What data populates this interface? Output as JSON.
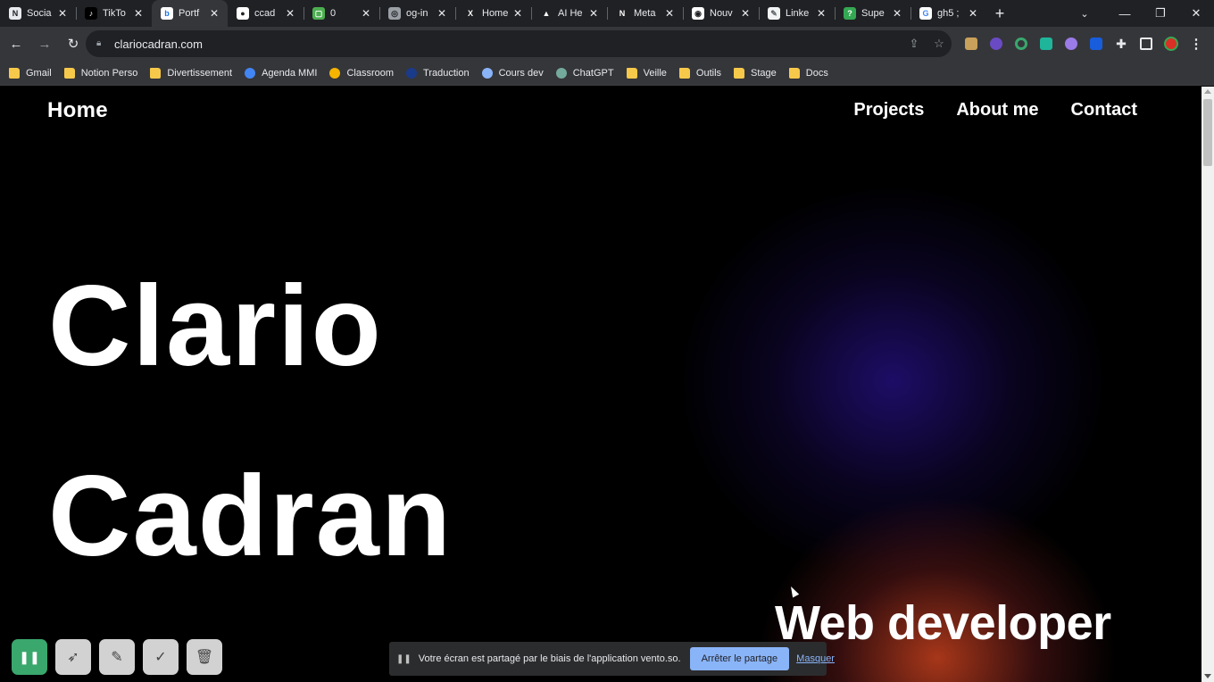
{
  "browser": {
    "tabs": [
      {
        "title": "Socia",
        "favicon_color": "#e8eaed",
        "favicon_text": "N",
        "favicon_fg": "#202124",
        "active": false
      },
      {
        "title": "TikTo",
        "favicon_color": "#000000",
        "favicon_text": "♪",
        "favicon_fg": "#ffffff",
        "active": false
      },
      {
        "title": "Portf",
        "favicon_color": "#ffffff",
        "favicon_text": "b",
        "favicon_fg": "#1a73e8",
        "active": true
      },
      {
        "title": "ccad",
        "favicon_color": "#ffffff",
        "favicon_text": "●",
        "favicon_fg": "#202124",
        "active": false
      },
      {
        "title": "0",
        "favicon_color": "#4caf50",
        "favicon_text": "▢",
        "favicon_fg": "#ffffff",
        "active": false
      },
      {
        "title": "og-in",
        "favicon_color": "#9aa0a6",
        "favicon_text": "◎",
        "favicon_fg": "#202124",
        "active": false
      },
      {
        "title": "Home",
        "favicon_color": "#202124",
        "favicon_text": "X",
        "favicon_fg": "#ffffff",
        "active": false
      },
      {
        "title": "AI He",
        "favicon_color": "#202124",
        "favicon_text": "▲",
        "favicon_fg": "#ffffff",
        "active": false
      },
      {
        "title": "Meta",
        "favicon_color": "#202124",
        "favicon_text": "N",
        "favicon_fg": "#ffffff",
        "active": false
      },
      {
        "title": "Nouv",
        "favicon_color": "#ffffff",
        "favicon_text": "◉",
        "favicon_fg": "#202124",
        "active": false
      },
      {
        "title": "Linke",
        "favicon_color": "#f1f3f4",
        "favicon_text": "✎",
        "favicon_fg": "#5f6368",
        "active": false
      },
      {
        "title": "Supe",
        "favicon_color": "#34a853",
        "favicon_text": "?",
        "favicon_fg": "#ffffff",
        "active": false
      },
      {
        "title": "gh5 ;",
        "favicon_color": "#ffffff",
        "favicon_text": "G",
        "favicon_fg": "#4285f4",
        "active": false
      }
    ],
    "new_tab_label": "+",
    "address": "clariocadran.com",
    "bookmarks": [
      {
        "label": "Gmail",
        "type": "folder"
      },
      {
        "label": "Notion Perso",
        "type": "folder"
      },
      {
        "label": "Divertissement",
        "type": "folder"
      },
      {
        "label": "Agenda MMI",
        "type": "calendar"
      },
      {
        "label": "Classroom",
        "type": "classroom"
      },
      {
        "label": "Traduction",
        "type": "translate"
      },
      {
        "label": "Cours dev",
        "type": "robot"
      },
      {
        "label": "ChatGPT",
        "type": "chatgpt"
      },
      {
        "label": "Veille",
        "type": "folder"
      },
      {
        "label": "Outils",
        "type": "folder"
      },
      {
        "label": "Stage",
        "type": "folder"
      },
      {
        "label": "Docs",
        "type": "folder"
      }
    ]
  },
  "page": {
    "nav_home": "Home",
    "nav_links": [
      "Projects",
      "About me",
      "Contact"
    ],
    "hero_first": "Clario",
    "hero_last": "Cadran",
    "subtitle": "Web developer"
  },
  "share_banner": {
    "message": "Votre écran est partagé par le biais de l'application vento.so.",
    "stop_label": "Arrêter le partage",
    "hide_label": "Masquer"
  },
  "colors": {
    "glow_blue": "#23107a",
    "glow_orange": "#c4401e",
    "record_green": "#3aa76d"
  }
}
